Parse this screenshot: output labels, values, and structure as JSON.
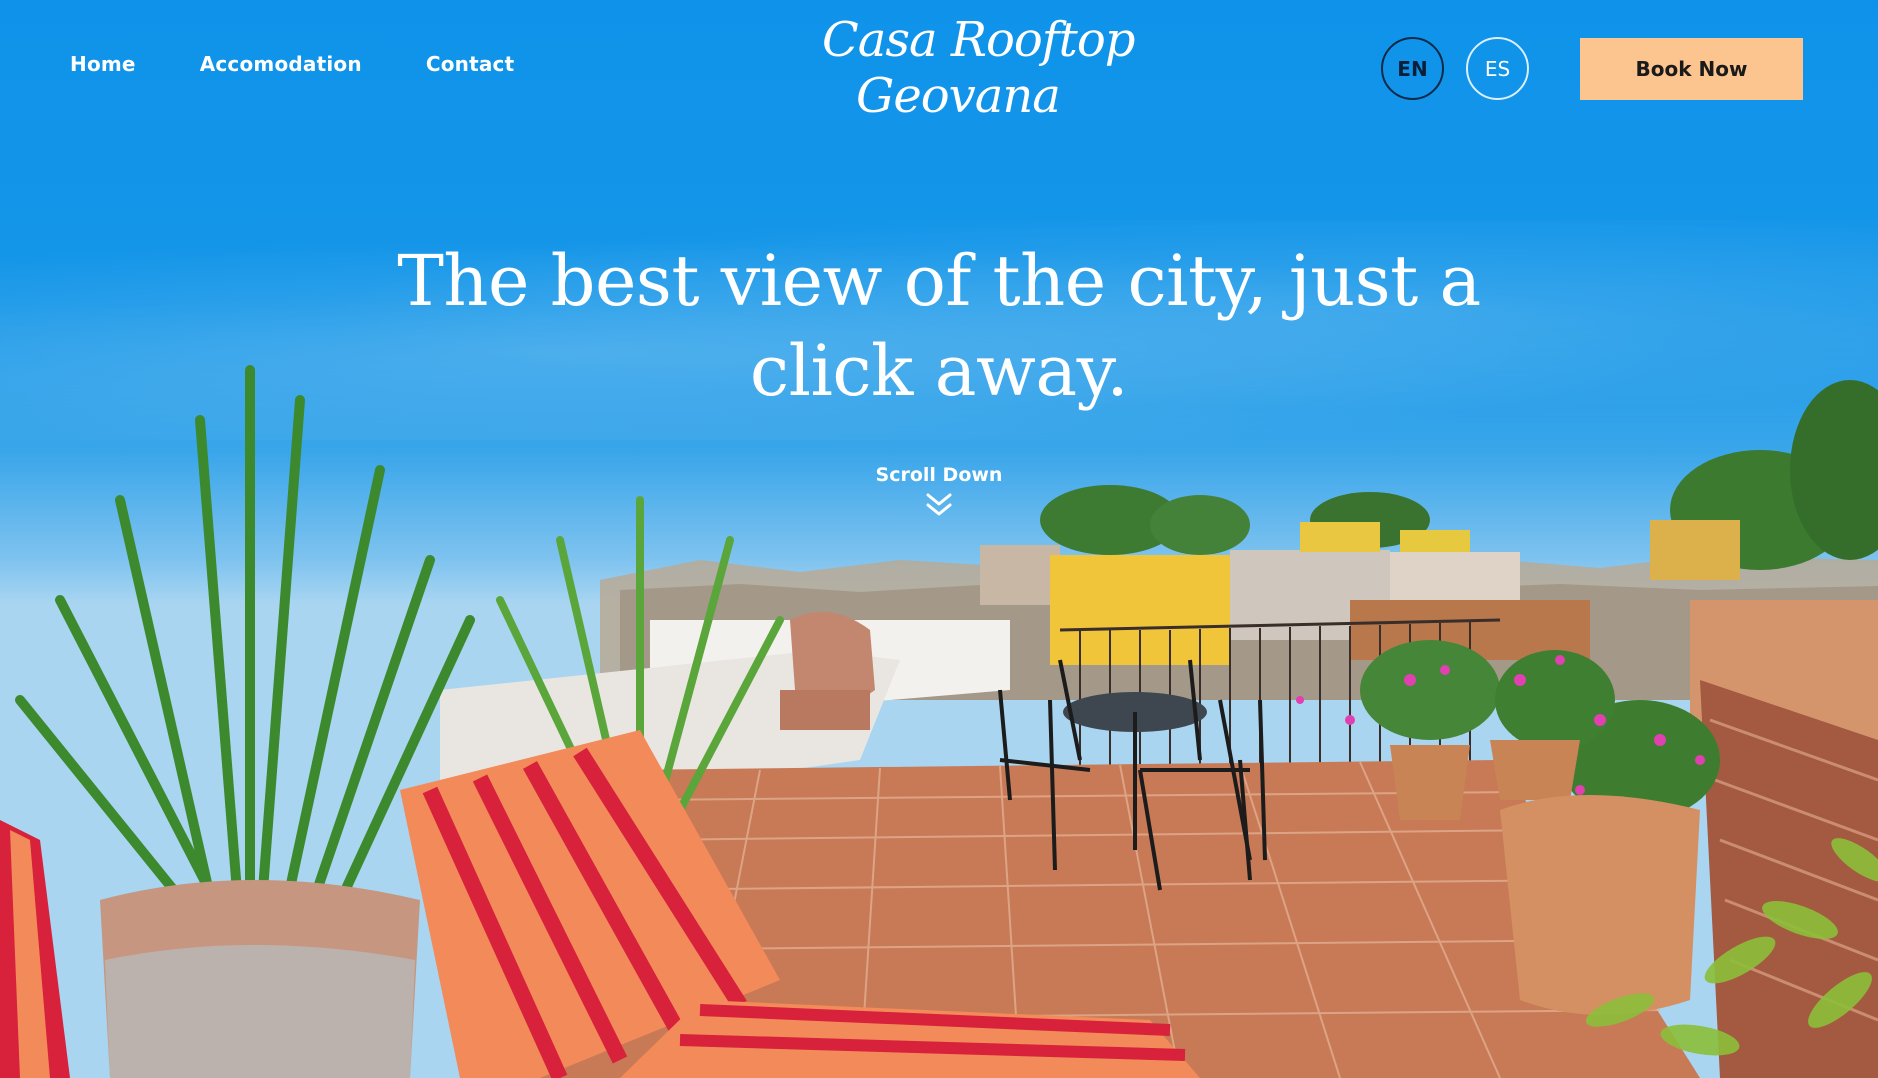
{
  "nav": {
    "items": [
      {
        "label": "Home"
      },
      {
        "label": "Accomodation"
      },
      {
        "label": "Contact"
      }
    ]
  },
  "logo": {
    "line1": "Casa Rooftop",
    "line2": "Geovana"
  },
  "language": {
    "options": [
      "EN",
      "ES"
    ],
    "selected": "EN"
  },
  "book_button": {
    "label": "Book Now"
  },
  "hero": {
    "title": "The best view of the city, just a click away.",
    "scroll_label": "Scroll Down"
  },
  "colors": {
    "accent_button": "#fcc48e",
    "sky": "#0f93ea"
  }
}
